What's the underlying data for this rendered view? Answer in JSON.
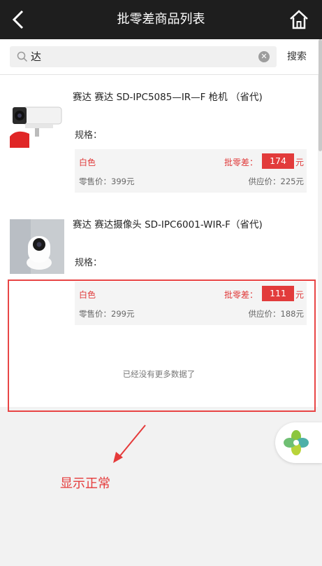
{
  "header": {
    "title": "批零差商品列表",
    "back_icon": "back-arrow-icon",
    "home_icon": "home-icon"
  },
  "search": {
    "query": "达",
    "button_label": "搜索",
    "search_icon": "search-icon",
    "clear_icon": "clear-icon"
  },
  "products": [
    {
      "name": "赛达  赛达 SD-IPC5085—IR—F 枪机 （省代)",
      "spec_label": "规格：",
      "variant": {
        "color": "白色",
        "diff_label": "批零差：",
        "diff_value": "174",
        "unit": "元",
        "retail_price": "零售价：399元",
        "supply_price": "供应价：225元"
      }
    },
    {
      "name": "赛达  赛达摄像头 SD-IPC6001-WIR-F（省代)",
      "spec_label": "规格：",
      "variant": {
        "color": "白色",
        "diff_label": "批零差：",
        "diff_value": "111",
        "unit": "元",
        "retail_price": "零售价：299元",
        "supply_price": "供应价：188元"
      }
    }
  ],
  "list_end_text": "已经没有更多数据了",
  "annotation": {
    "text": "显示正常",
    "color": "#e53a3a"
  },
  "colors": {
    "header_bg": "#1e1e1e",
    "accent_red": "#e23b3b"
  }
}
